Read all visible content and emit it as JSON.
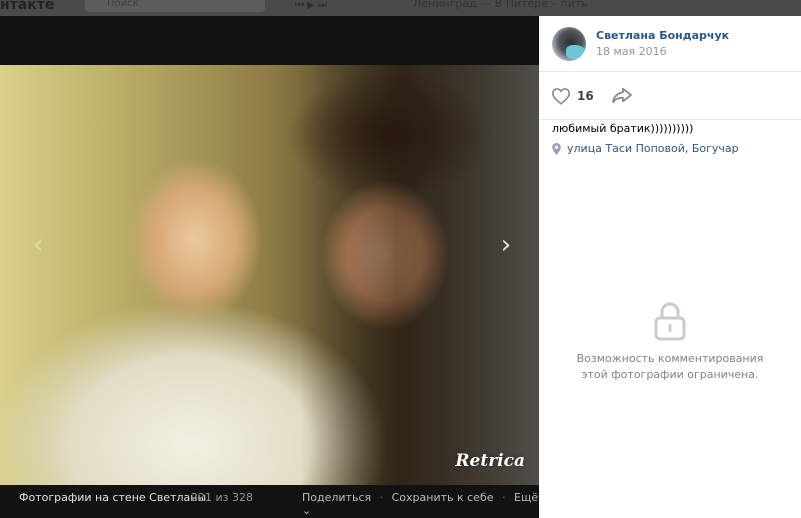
{
  "background_header": {
    "site_logo": "нтакте",
    "search_placeholder": "Поиск",
    "now_playing": "Ленинград — В Питере – пить"
  },
  "photo": {
    "watermark": "Retrica",
    "prev_icon": "chevron-left-icon",
    "next_icon": "chevron-right-icon"
  },
  "footer": {
    "album_title": "Фотографии на стене Светланы",
    "counter": "221 из 328",
    "share_label": "Поделиться",
    "save_label": "Сохранить к себе",
    "more_label": "Ещё ⌄",
    "separator": "·"
  },
  "author": {
    "name": "Светлана Бондарчук",
    "date": "18 мая 2016",
    "avatar_icon": "user-avatar"
  },
  "social": {
    "like_count": "16",
    "like_icon": "heart-icon",
    "share_icon": "share-arrow-icon"
  },
  "caption": "любимый братик))))))))))",
  "location": "улица Таси Поповой, Богучар",
  "comments_restricted": {
    "message": "Возможность комментирования этой фотографии ограничена."
  },
  "colors": {
    "link": "#2a5885",
    "muted": "#939699",
    "viewer_bg": "#121212",
    "sidebar_bg": "#ffffff"
  }
}
